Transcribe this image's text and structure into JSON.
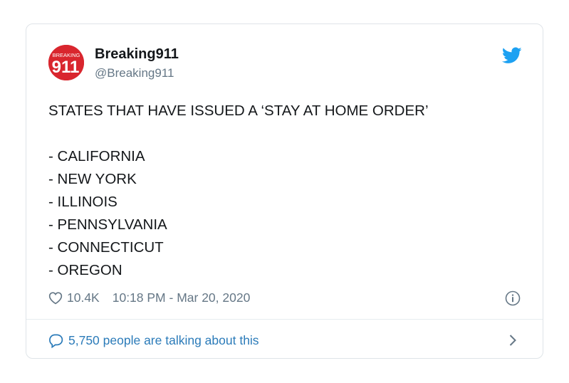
{
  "tweet": {
    "author_name": "Breaking911",
    "author_handle": "@Breaking911",
    "avatar_text": "911",
    "avatar_small_text": "BREAKING",
    "text": "STATES THAT HAVE ISSUED A ‘STAY AT HOME ORDER’\n\n- CALIFORNIA\n- NEW YORK\n- ILLINOIS\n- PENNSYLVANIA\n- CONNECTICUT\n- OREGON",
    "likes": "10.4K",
    "timestamp": "10:18 PM - Mar 20, 2020",
    "talking": "5,750 people are talking about this"
  },
  "icons": {
    "logo": "twitter-bird-icon",
    "like": "heart-icon",
    "info": "info-icon",
    "reply": "speech-bubble-icon",
    "chevron": "chevron-right-icon"
  },
  "colors": {
    "brand": "#1da1f2",
    "link": "#2b7bb9",
    "muted": "#657786",
    "avatar": "#d9262e"
  }
}
